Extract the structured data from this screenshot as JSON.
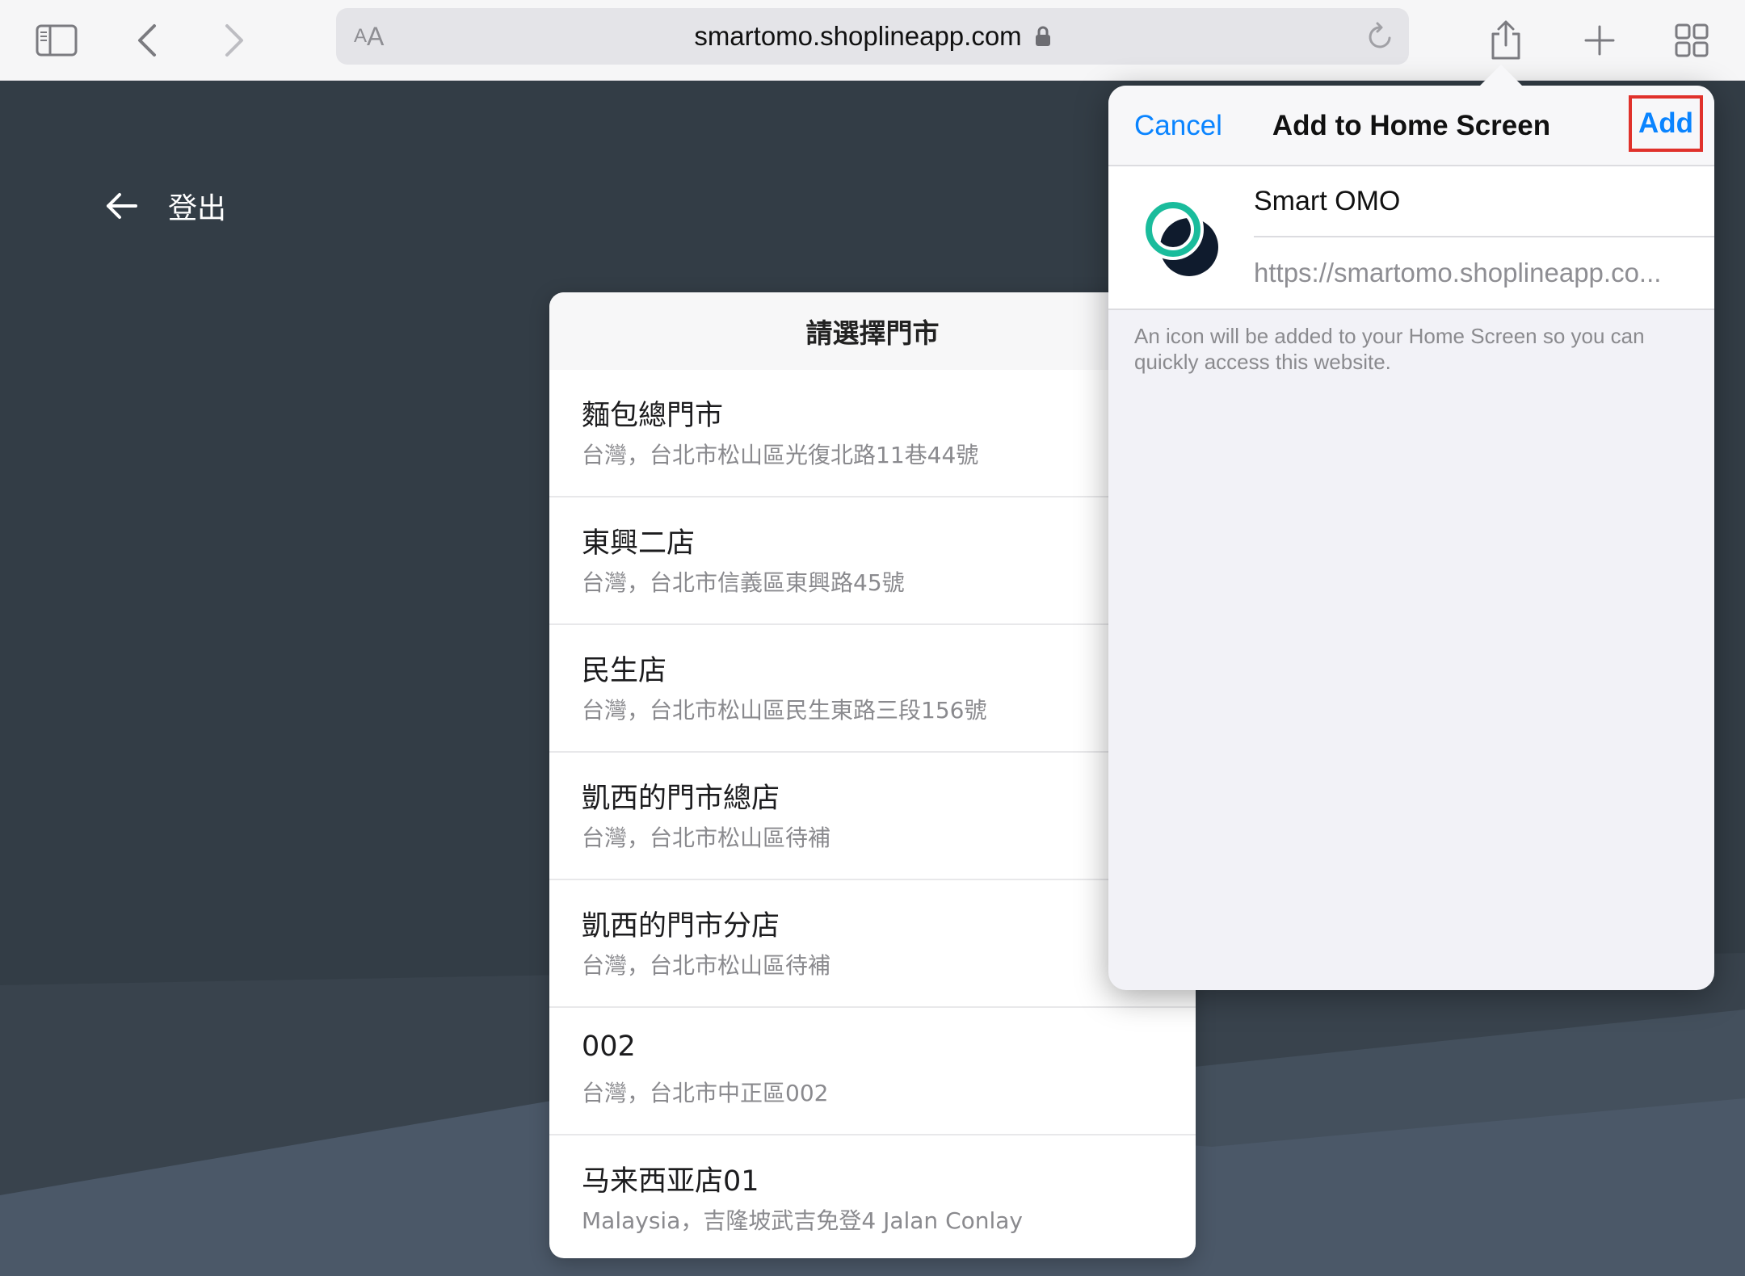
{
  "browser": {
    "url": "smartomo.shoplineapp.com",
    "reader_label_small": "A",
    "reader_label_large": "A",
    "icons": {
      "sidebar": "sidebar-icon",
      "back": "chevron-left-icon",
      "forward": "chevron-right-icon",
      "lock": "lock-icon",
      "reload": "reload-icon",
      "share": "share-icon",
      "new_tab": "plus-icon",
      "tabs": "tabs-grid-icon"
    }
  },
  "page": {
    "back_label": "登出",
    "picker_title": "請選擇門市",
    "stores": [
      {
        "name": "麵包總門市",
        "address": "台灣，台北市松山區光復北路11巷44號"
      },
      {
        "name": "東興二店",
        "address": "台灣，台北市信義區東興路45號"
      },
      {
        "name": "民生店",
        "address": "台灣，台北市松山區民生東路三段156號"
      },
      {
        "name": "凱西的門市總店",
        "address": "台灣，台北市松山區待補"
      },
      {
        "name": "凱西的門市分店",
        "address": "台灣，台北市松山區待補"
      },
      {
        "name": "002",
        "address": "台灣，台北市中正區002"
      },
      {
        "name": "马来西亚店01",
        "address": "Malaysia，吉隆坡武吉免登4 Jalan Conlay"
      }
    ]
  },
  "popover": {
    "cancel_label": "Cancel",
    "title": "Add to Home Screen",
    "add_label": "Add",
    "app_name": "Smart OMO",
    "app_url": "https://smartomo.shoplineapp.co...",
    "note": "An icon will be added to your Home Screen so you can quickly access this website."
  },
  "colors": {
    "accent": "#0a84ff",
    "highlight_border": "#e0312b",
    "page_background": "#333d46",
    "logo_teal": "#1abc9c",
    "logo_navy": "#0f1b2d"
  }
}
